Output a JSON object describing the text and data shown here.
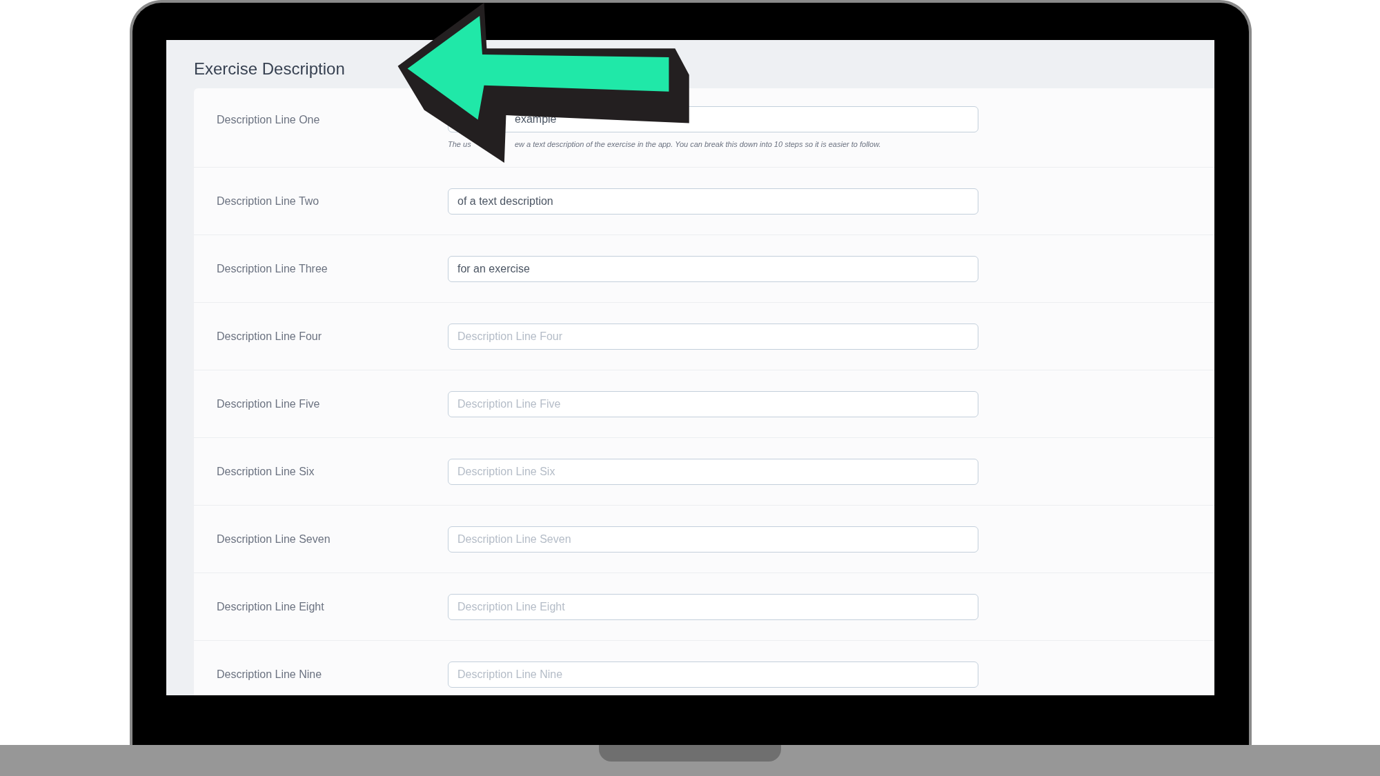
{
  "section": {
    "title": "Exercise Description"
  },
  "rows": [
    {
      "kind": "covered",
      "label": "Description Line One",
      "value": "example",
      "hint_parts": [
        "The us",
        "ew a text description of the exercise in the app. You can break this down into 10 steps so it is easier to follow."
      ]
    },
    {
      "kind": "text",
      "label": "Description Line Two",
      "value": "of a text description"
    },
    {
      "kind": "text",
      "label": "Description Line Three",
      "value": "for an exercise"
    },
    {
      "kind": "text",
      "label": "Description Line Four",
      "placeholder": "Description Line Four"
    },
    {
      "kind": "text",
      "label": "Description Line Five",
      "placeholder": "Description Line Five"
    },
    {
      "kind": "text",
      "label": "Description Line Six",
      "placeholder": "Description Line Six"
    },
    {
      "kind": "text",
      "label": "Description Line Seven",
      "placeholder": "Description Line Seven"
    },
    {
      "kind": "text",
      "label": "Description Line Eight",
      "placeholder": "Description Line Eight"
    },
    {
      "kind": "text",
      "label": "Description Line Nine",
      "placeholder": "Description Line Nine"
    }
  ]
}
